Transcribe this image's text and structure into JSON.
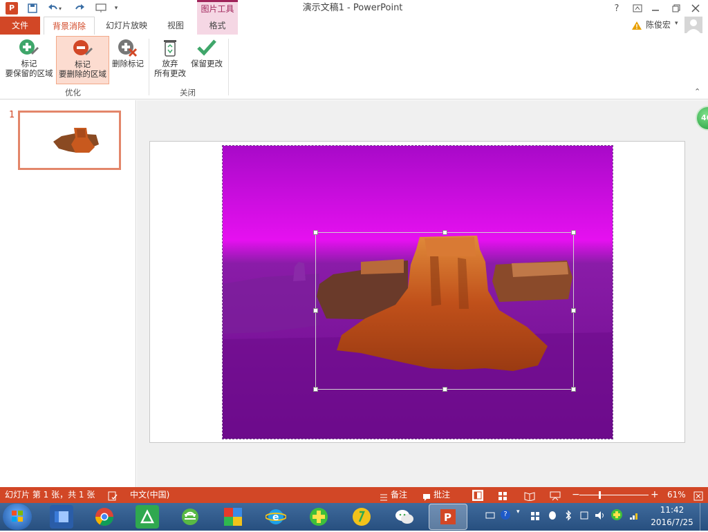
{
  "window": {
    "title": "演示文稿1 - PowerPoint",
    "context_group": "图片工具",
    "help": "?"
  },
  "tabs": {
    "file": "文件",
    "active": "背景消除",
    "slideshow": "幻灯片放映",
    "view": "视图",
    "format": "格式"
  },
  "user": {
    "name": "陈俊宏"
  },
  "ribbon": {
    "mark_keep_line1": "标记",
    "mark_keep_line2": "要保留的区域",
    "mark_remove_line1": "标记",
    "mark_remove_line2": "要删除的区域",
    "delete_mark": "删除标记",
    "discard_line1": "放弃",
    "discard_line2": "所有更改",
    "keep_changes": "保留更改",
    "group_refine": "优化",
    "group_close": "关闭"
  },
  "thumbnails": [
    {
      "number": "1"
    }
  ],
  "side_badge": "46",
  "status": {
    "slide_info": "幻灯片 第 1 张，共 1 张",
    "language": "中文(中国)",
    "notes": "备注",
    "comments": "批注",
    "zoom": "61%"
  },
  "taskbar": {
    "time": "11:42",
    "date": "2016/7/25"
  },
  "colors": {
    "accent": "#d24726",
    "context": "#a0245a",
    "removal_magenta": "#b000c8"
  }
}
